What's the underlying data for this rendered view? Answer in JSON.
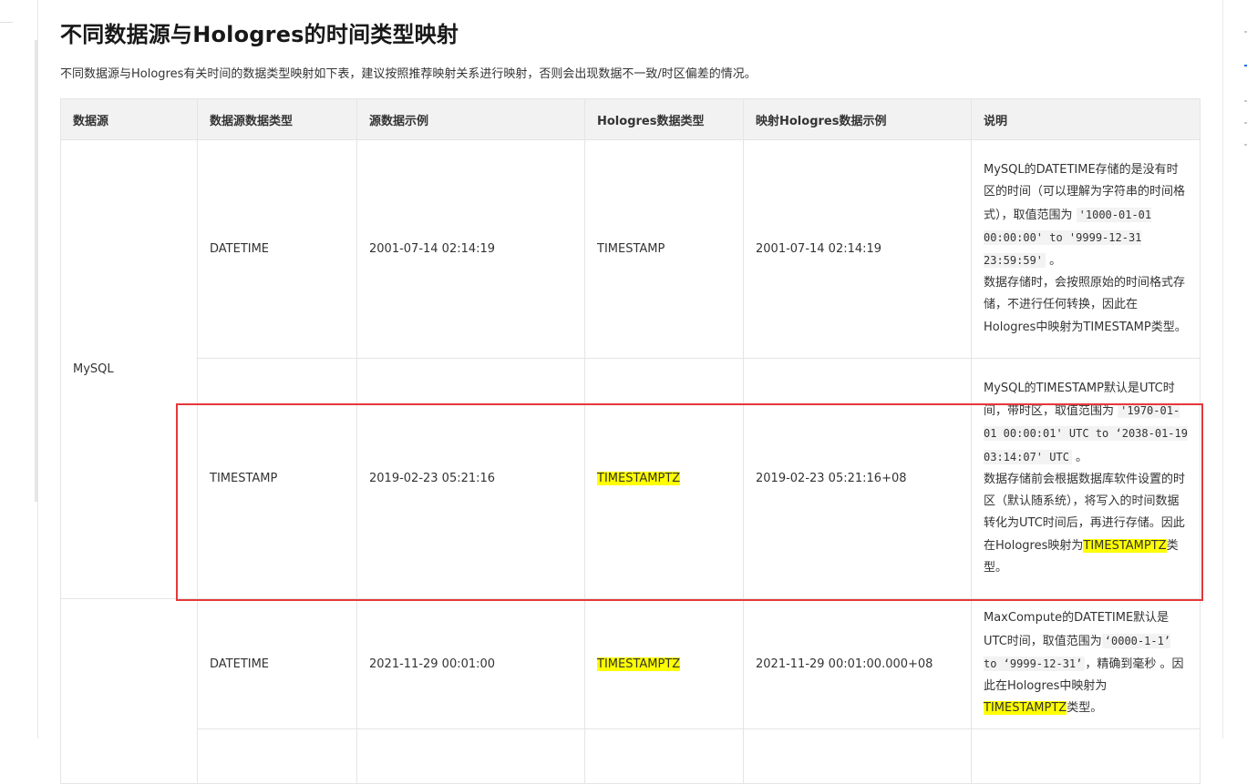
{
  "title": "不同数据源与Hologres的时间类型映射",
  "intro": "不同数据源与Hologres有关时间的数据类型映射如下表，建议按照推荐映射关系进行映射，否则会出现数据不一致/时区偏差的情况。",
  "table": {
    "headers": [
      "数据源",
      "数据源数据类型",
      "源数据示例",
      "Hologres数据类型",
      "映射Hologres数据示例",
      "说明"
    ],
    "rows": [
      {
        "source": "MySQL",
        "type": "DATETIME",
        "example": "2001-07-14 02:14:19",
        "holo_type": "TIMESTAMP",
        "holo_example": "2001-07-14 02:14:19",
        "desc": {
          "t1": "MySQL的DATETIME存储的是没有时区的时间（可以理解为字符串的时间格式），取值范围为 ",
          "c1": "'1000-01-01 00:00:00' to '9999-12-31 23:59:59'",
          "t2": " 。",
          "t3": "数据存储时，会按照原始的时间格式存储，不进行任何转换，因此在Hologres中映射为TIMESTAMP类型。"
        }
      },
      {
        "type": "TIMESTAMP",
        "example": "2019-02-23 05:21:16",
        "holo_type": "TIMESTAMPTZ",
        "holo_example": "2019-02-23 05:21:16+08",
        "desc": {
          "t1": "MySQL的TIMESTAMP默认是UTC时间，带时区，取值范围为 ",
          "c1": "'1970-01-01 00:00:01' UTC to ‘2038-01-19 03:14:07' UTC",
          "t2": " 。",
          "t3": "数据存储前会根据数据库软件设置的时区（默认随系统），将写入的时间数据转化为UTC时间后，再进行存储。因此在Hologres映射为",
          "hl": "TIMESTAMPTZ",
          "t4": "类型。"
        }
      },
      {
        "source": "",
        "type": "DATETIME",
        "example": "2021-11-29 00:01:00",
        "holo_type": "TIMESTAMPTZ",
        "holo_example": "2021-11-29 00:01:00.000+08",
        "desc": {
          "t1": "MaxCompute的DATETIME默认是UTC时间，取值范围为",
          "c1": "‘0000-1-1’ to ‘9999-12-31’",
          "t2": "，精确到毫秒 。因此在Hologres中映射为",
          "hl": "TIMESTAMPTZ",
          "t3": "类型。"
        }
      }
    ]
  },
  "colors": {
    "highlight": "#ffff00",
    "selection_border": "#e6373b",
    "header_bg": "#f2f2f2"
  }
}
